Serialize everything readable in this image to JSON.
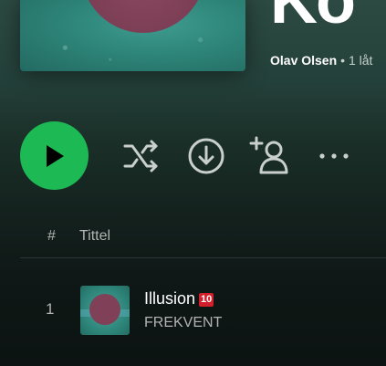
{
  "header": {
    "title": "Ko",
    "artist": "Olav Olsen",
    "meta": "• 1 låt"
  },
  "controls": {
    "play": "play-icon",
    "shuffle": "shuffle-icon",
    "download": "download-icon",
    "follow": "add-user-icon",
    "more": "more-icon"
  },
  "columns": {
    "number": "#",
    "title": "Tittel"
  },
  "tracks": [
    {
      "number": "1",
      "title": "Illusion",
      "rating_badge": "10",
      "artist": "FREKVENT"
    }
  ],
  "colors": {
    "play_green": "#1db954",
    "badge_red": "#d21f2b",
    "muted_text": "#b3b3b3"
  }
}
